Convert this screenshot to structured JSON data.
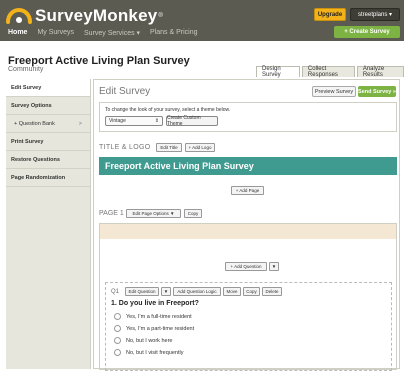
{
  "header": {
    "logo_text": "SurveyMonkey",
    "logo_reg": "®",
    "upgrade_label": "Upgrade",
    "user_label": "streetplans ▾",
    "nav": [
      "Home",
      "My Surveys",
      "Survey Services ▾",
      "Plans & Pricing"
    ],
    "create_label": "+ Create Survey"
  },
  "survey": {
    "title": "Freeport Active Living Plan Survey",
    "subtitle": "Community"
  },
  "tabs": [
    "Design Survey",
    "Collect Responses",
    "Analyze Results"
  ],
  "sidebar": {
    "items": [
      {
        "label": "Edit Survey"
      },
      {
        "label": "Survey Options"
      },
      {
        "label": "+ Question Bank",
        "chevron": ">"
      },
      {
        "label": "Print Survey"
      },
      {
        "label": "Restore Questions"
      },
      {
        "label": "Page Randomization"
      }
    ]
  },
  "main": {
    "heading": "Edit Survey",
    "preview_label": "Preview Survey",
    "send_label": "Send Survey »",
    "theme_text": "To change the look of your survey, select a theme below.",
    "theme_value": "Vintage",
    "custom_theme_label": "Create Custom Theme",
    "title_logo_label": "TITLE & LOGO",
    "edit_title_label": "Edit Title",
    "add_logo_label": "+ Add Logo",
    "survey_band_title": "Freeport Active Living Plan Survey",
    "add_page_label": "+ Add Page",
    "page_label": "PAGE 1",
    "edit_page_options_label": "Edit Page Options ▼",
    "page_copy_label": "Copy",
    "add_question_label": "+ Add Question",
    "add_question_arrow": "▼"
  },
  "question": {
    "number": "Q1",
    "buttons": [
      "Edit Question",
      "▼",
      "Add Question Logic",
      "Move",
      "Copy",
      "Delete"
    ],
    "text": "1. Do you live in Freeport?",
    "options": [
      "Yes, I'm a full-time resident",
      "Yes, I'm a part-time resident",
      "No, but I work here",
      "No, but I visit frequently"
    ]
  },
  "colors": {
    "header_bg": "#5b5b51",
    "accent_green": "#7cb342",
    "upgrade_yellow": "#f3b21a",
    "title_band": "#3f9a8f",
    "page_band": "#f4e7d4"
  }
}
